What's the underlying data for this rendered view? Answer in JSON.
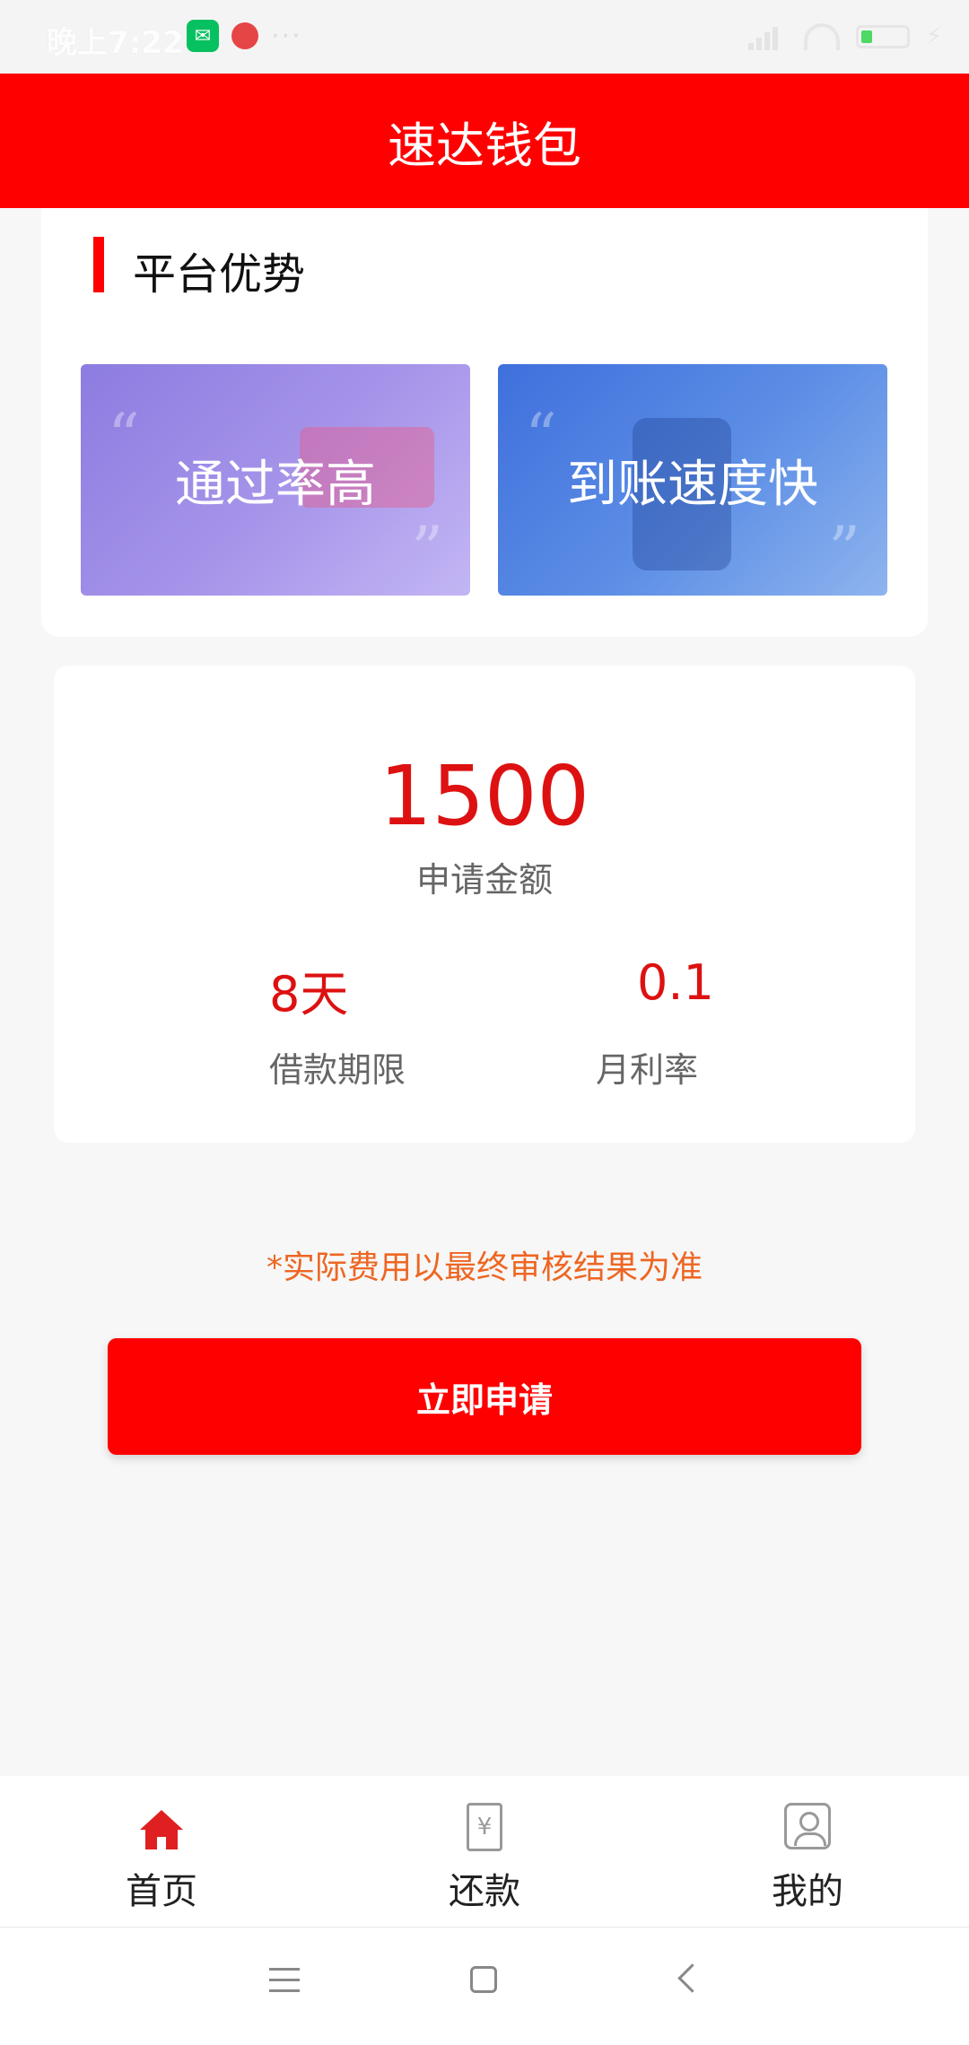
{
  "status_bar": {
    "time": "晚上7:22",
    "dots": "···",
    "wechat_icon": "wechat-icon",
    "notification_icon": "app-notification-icon",
    "signal_icon": "signal-icon",
    "wifi_icon": "wifi-icon",
    "battery_icon": "battery-icon",
    "charging_icon": "charging-icon"
  },
  "header": {
    "title": "速达钱包",
    "color": "#ff0000"
  },
  "advantages": {
    "title": "平台优势",
    "tiles": [
      {
        "label": "通过率高"
      },
      {
        "label": "到账速度快"
      }
    ]
  },
  "loan": {
    "amount": "1500",
    "amount_label": "申请金额",
    "term_value": "8天",
    "term_label": "借款期限",
    "rate_value": "0.1",
    "rate_label": "月利率"
  },
  "notice": "*实际费用以最终审核结果为准",
  "apply_button": {
    "label": "立即申请"
  },
  "tabs": [
    {
      "label": "首页",
      "icon": "home-icon",
      "active": true
    },
    {
      "label": "还款",
      "icon": "bill-icon",
      "active": false
    },
    {
      "label": "我的",
      "icon": "user-icon",
      "active": false
    }
  ],
  "system_nav": {
    "menu_icon": "menu-icon",
    "home_icon": "square-home-icon",
    "back_icon": "back-icon"
  },
  "colors": {
    "accent": "#ff0000",
    "value_red": "#dd1111",
    "notice_orange": "#ee6622"
  }
}
